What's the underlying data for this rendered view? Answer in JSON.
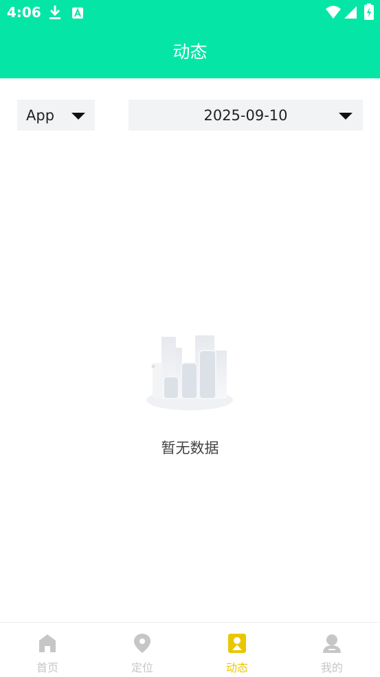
{
  "status_bar": {
    "time": "4:06"
  },
  "header": {
    "title": "动态"
  },
  "filters": {
    "app_select": {
      "value": "App"
    },
    "date_select": {
      "value": "2025-09-10"
    }
  },
  "empty_state": {
    "text": "暂无数据"
  },
  "tabs": [
    {
      "label": "首页",
      "icon": "home-icon",
      "active": false
    },
    {
      "label": "定位",
      "icon": "location-pin-icon",
      "active": false
    },
    {
      "label": "动态",
      "icon": "activity-bookmark-icon",
      "active": true
    },
    {
      "label": "我的",
      "icon": "profile-icon",
      "active": false
    }
  ],
  "colors": {
    "brand": "#05E6A6",
    "active_tab": "#E8C700",
    "inactive_tab": "#C6C6C6",
    "select_bg": "#F2F3F5"
  }
}
